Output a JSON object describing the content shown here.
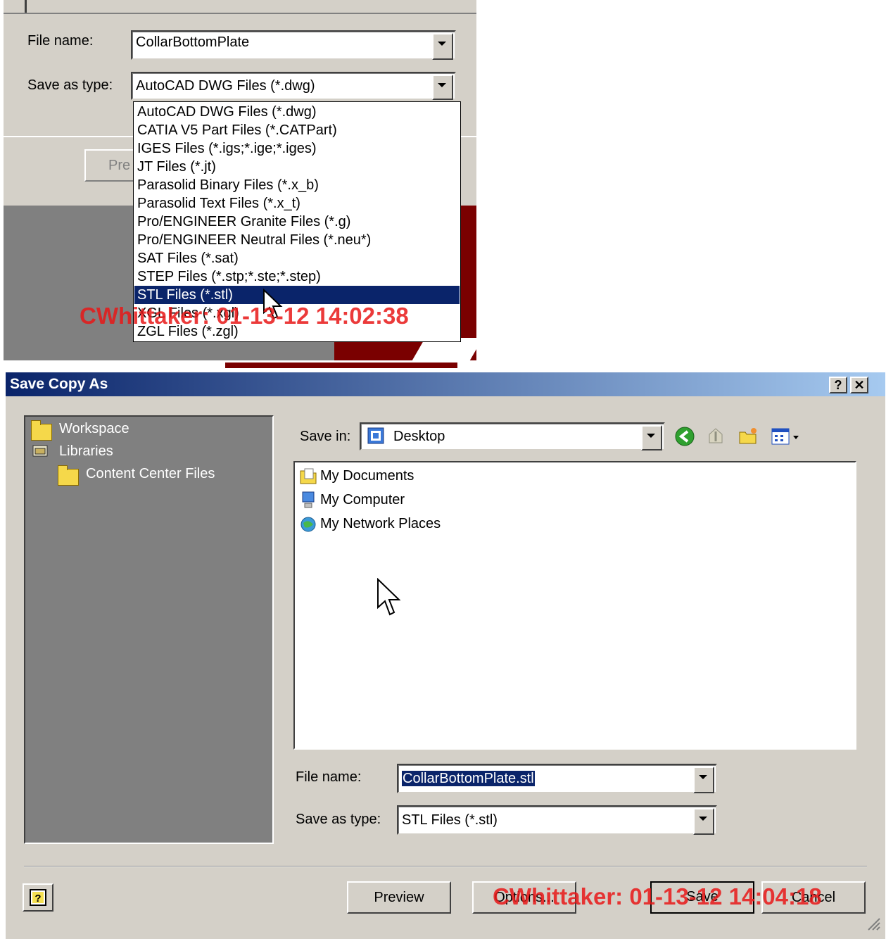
{
  "top": {
    "file_name_label": "File name:",
    "file_name_value": "CollarBottomPlate",
    "type_label": "Save as type:",
    "type_value": "AutoCAD DWG Files (*.dwg)",
    "preview_partial": "Pre",
    "dropdown_options": [
      "AutoCAD DWG Files (*.dwg)",
      "CATIA V5 Part Files (*.CATPart)",
      "IGES Files (*.igs;*.ige;*.iges)",
      "JT Files (*.jt)",
      "Parasolid Binary Files (*.x_b)",
      "Parasolid Text Files (*.x_t)",
      "Pro/ENGINEER Granite Files (*.g)",
      "Pro/ENGINEER Neutral Files (*.neu*)",
      "SAT Files (*.sat)",
      "STEP Files (*.stp;*.ste;*.step)",
      "STL Files (*.stl)",
      "XGL Files (*.xgl)",
      "ZGL Files (*.zgl)"
    ],
    "selected_option": "STL Files (*.stl)",
    "watermark": "CWhittaker: 01-13-12 14:02:38"
  },
  "dialog": {
    "title": "Save Copy As",
    "help_glyph": "?",
    "close_glyph": "✕",
    "tree": [
      "Workspace",
      "Libraries",
      "Content Center Files"
    ],
    "save_in_label": "Save in:",
    "save_in_value": "Desktop",
    "files": [
      "My Documents",
      "My Computer",
      "My Network Places"
    ],
    "file_name_label": "File name:",
    "file_name_value": "CollarBottomPlate.stl",
    "type_label": "Save as type:",
    "type_value": "STL Files (*.stl)",
    "buttons": {
      "preview": "Preview",
      "options": "Options...",
      "save": "Save",
      "cancel": "Cancel"
    },
    "watermark": "CWhittaker: 01-13-12 14:04:18"
  }
}
